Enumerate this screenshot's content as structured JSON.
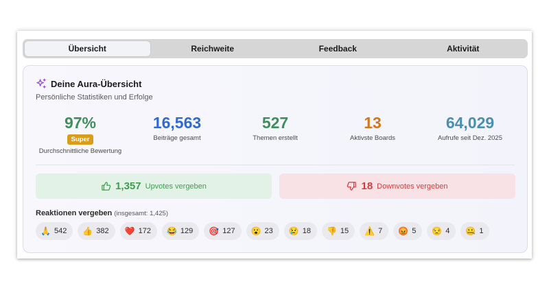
{
  "tabs": [
    {
      "label": "Übersicht",
      "active": true
    },
    {
      "label": "Reichweite",
      "active": false
    },
    {
      "label": "Feedback",
      "active": false
    },
    {
      "label": "Aktivität",
      "active": false
    }
  ],
  "overview": {
    "title": "Deine Aura-Übersicht",
    "title_icon": "sparkles-icon",
    "subtitle": "Persönliche Statistiken und Erfolge"
  },
  "stats": [
    {
      "value": "97%",
      "label": "Durchschnittliche Bewertung",
      "badge": "Super",
      "color": "#3f8f5c"
    },
    {
      "value": "16,563",
      "label": "Beiträge gesamt",
      "color": "#2f6ad3"
    },
    {
      "value": "527",
      "label": "Themen erstellt",
      "color": "#3f8f5c"
    },
    {
      "value": "13",
      "label": "Aktivste Boards",
      "color": "#d0791c"
    },
    {
      "value": "64,029",
      "label": "Aufrufe seit Dez. 2025",
      "color": "#4a8fb2"
    }
  ],
  "upvotes": {
    "count": "1,357",
    "label": "Upvotes vergeben",
    "icon": "thumbs-up-icon"
  },
  "downvotes": {
    "count": "18",
    "label": "Downvotes vergeben",
    "icon": "thumbs-down-icon"
  },
  "reactions": {
    "title": "Reaktionen vergeben",
    "total": "(insgesamt: 1,425)",
    "items": [
      {
        "emoji": "🙏",
        "count": "542"
      },
      {
        "emoji": "👍",
        "count": "382"
      },
      {
        "emoji": "❤️",
        "count": "172"
      },
      {
        "emoji": "😂",
        "count": "129"
      },
      {
        "emoji": "🎯",
        "count": "127"
      },
      {
        "emoji": "😮",
        "count": "23"
      },
      {
        "emoji": "😢",
        "count": "18"
      },
      {
        "emoji": "👎",
        "count": "15"
      },
      {
        "emoji": "⚠️",
        "count": "7"
      },
      {
        "emoji": "😡",
        "count": "5"
      },
      {
        "emoji": "😒",
        "count": "4"
      },
      {
        "emoji": "🤐",
        "count": "1"
      }
    ]
  }
}
